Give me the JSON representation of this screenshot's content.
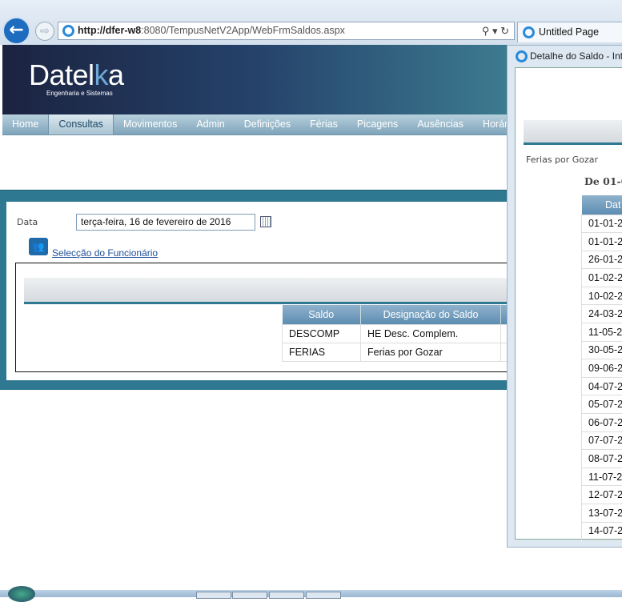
{
  "browser": {
    "url_host": "http://dfer-w8",
    "url_rest": ":8080/TempusNetV2App/WebFrmSaldos.aspx",
    "tab_title": "Untitled Page",
    "tools": "⚲ ▾ ↻"
  },
  "header": {
    "logo_main": "Datel",
    "logo_accent": "ka",
    "logo_k": "k",
    "tagline": "Engenharia e Sistemas"
  },
  "nav": {
    "items": [
      "Home",
      "Consultas",
      "Movimentos",
      "Admin",
      "Definições",
      "Férias",
      "Picagens",
      "Ausências",
      "Horários"
    ],
    "active": "Consultas"
  },
  "form": {
    "date_label": "Data",
    "date_value": "terça-feira, 16 de fevereiro de 2016",
    "employee_link": "Selecção do Funcionário"
  },
  "saldos_table": {
    "headers": [
      "Saldo",
      "Designação do Saldo"
    ],
    "rows": [
      [
        "DESCOMP",
        "HE Desc. Complem."
      ],
      [
        "FERIAS",
        "Ferias por Gozar"
      ]
    ]
  },
  "popup": {
    "title": "Detalhe do Saldo - Int",
    "subtitle": "Ferias por Gozar",
    "range": "De 01-0",
    "header": "Dat",
    "dates": [
      "01-01-2",
      "01-01-2",
      "26-01-2",
      "01-02-2",
      "10-02-2",
      "24-03-2",
      "11-05-2",
      "30-05-2",
      "09-06-2",
      "04-07-2",
      "05-07-2",
      "06-07-2",
      "07-07-2",
      "08-07-2",
      "11-07-2",
      "12-07-2",
      "13-07-2",
      "14-07-2"
    ]
  },
  "colors": {
    "accent": "#2e7891",
    "header_dark": "#1b2340",
    "link": "#1f4f9a"
  }
}
